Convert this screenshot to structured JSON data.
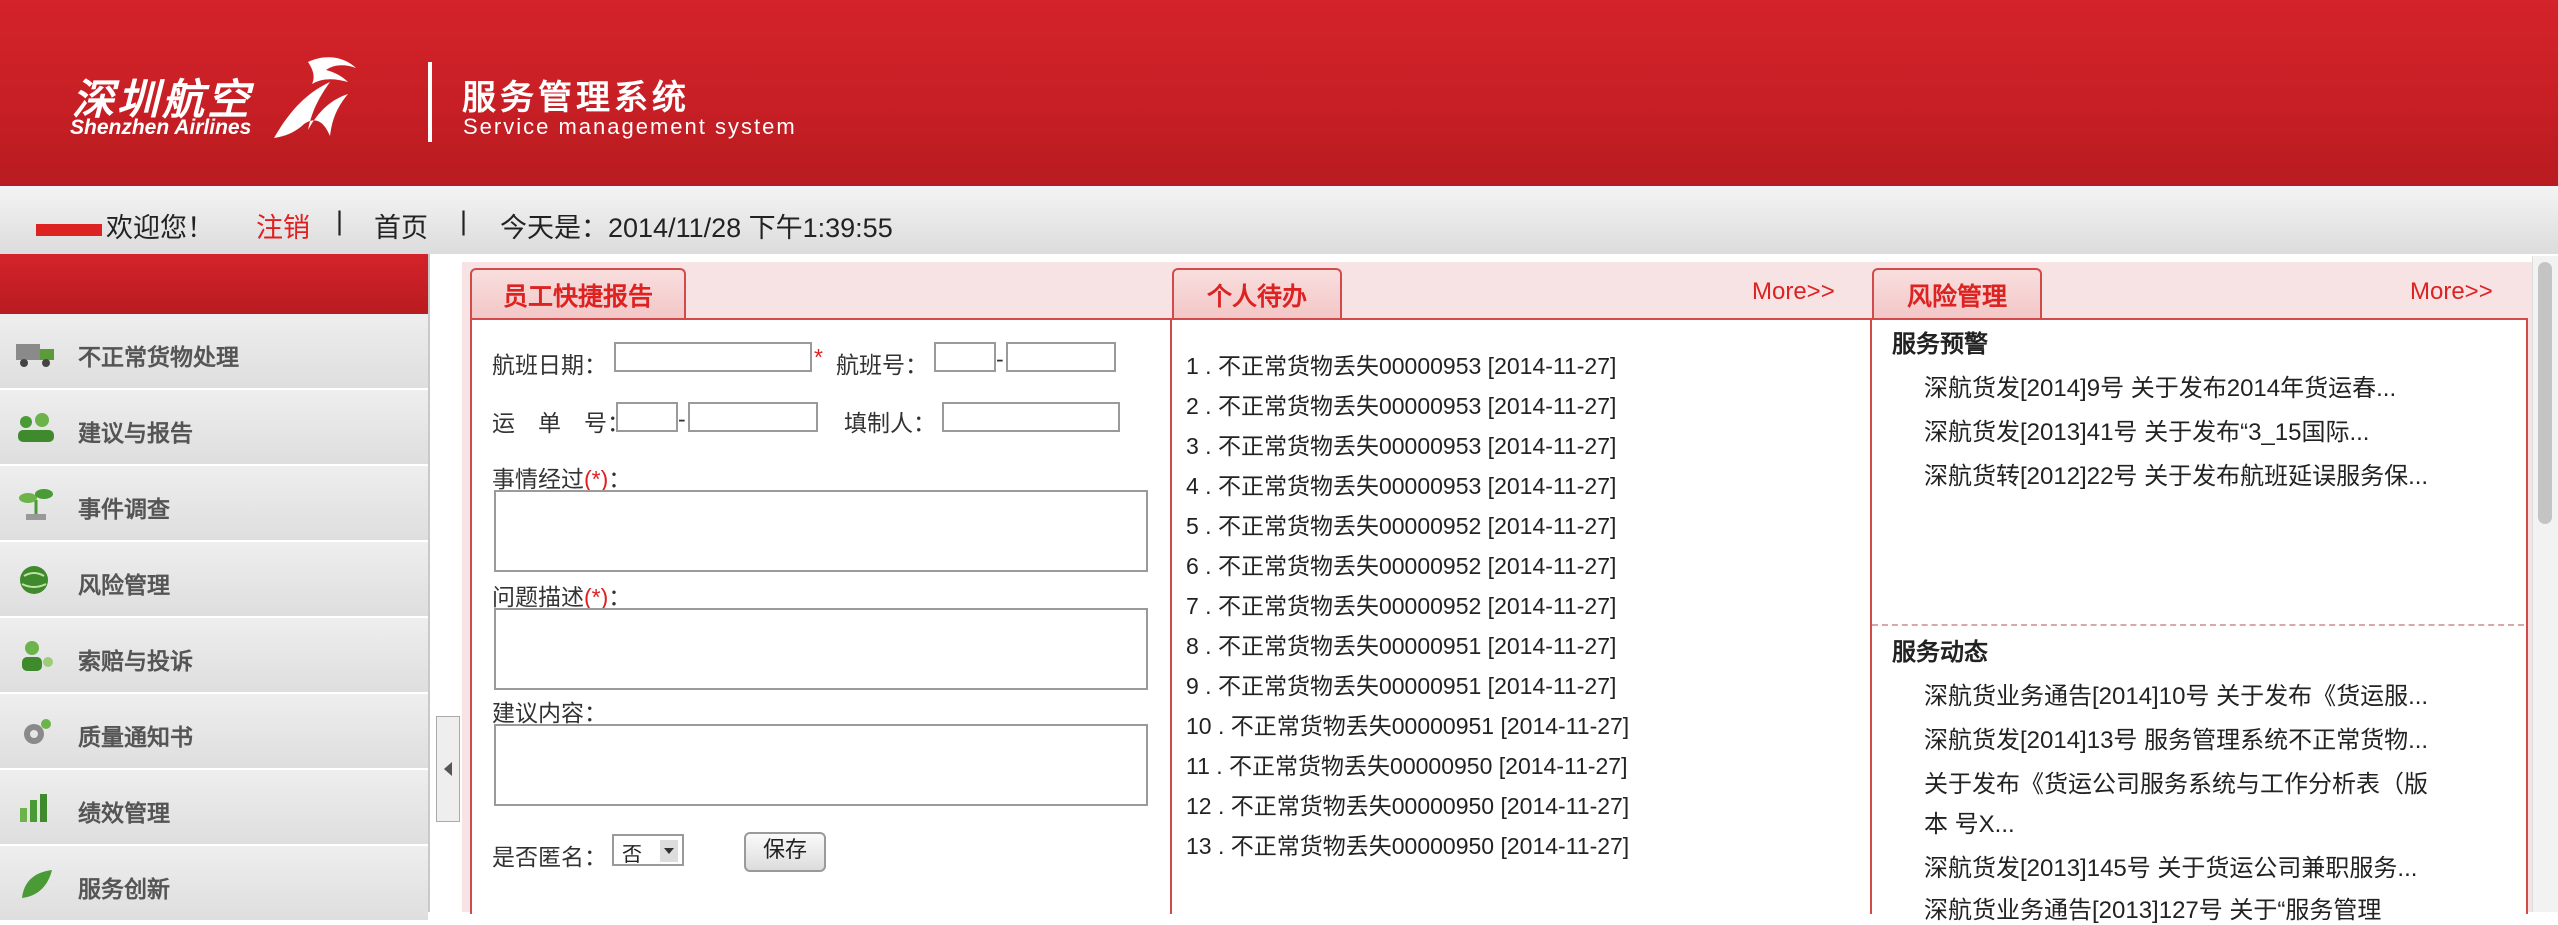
{
  "header": {
    "brand_cn": "深圳航空",
    "brand_en": "Shenzhen Airlines",
    "system_cn": "服务管理系统",
    "system_en": "Service management system"
  },
  "infobar": {
    "welcome": "欢迎您！",
    "logout": "注销",
    "sep": "|",
    "home": "首页",
    "today": "今天是：2014/11/28 下午1:39:55"
  },
  "sidebar": {
    "items": [
      {
        "label": "不正常货物处理",
        "icon": "truck-icon"
      },
      {
        "label": "建议与报告",
        "icon": "people-icon"
      },
      {
        "label": "事件调查",
        "icon": "plant-icon"
      },
      {
        "label": "风险管理",
        "icon": "globe-icon"
      },
      {
        "label": "索赔与投诉",
        "icon": "person-icon"
      },
      {
        "label": "质量通知书",
        "icon": "gear-icon"
      },
      {
        "label": "绩效管理",
        "icon": "chart-icon"
      },
      {
        "label": "服务创新",
        "icon": "leaf-icon"
      }
    ]
  },
  "report": {
    "tab": "员工快捷报告",
    "flight_date": "航班日期：",
    "flight_no": "航班号：",
    "dash": "-",
    "waybill": "运　单　号：",
    "filler": "填制人：",
    "process": "事情经过",
    "problem": "问题描述",
    "required": "(*)",
    "star": "*",
    "colon": "：",
    "suggestion": "建议内容：",
    "anonymous": "是否匿名：",
    "anonymous_value": "否",
    "save": "保存"
  },
  "todo": {
    "tab": "个人待办",
    "more": "More>>",
    "items": [
      "1 . 不正常货物丢失00000953 [2014-11-27]",
      "2 . 不正常货物丢失00000953 [2014-11-27]",
      "3 . 不正常货物丢失00000953 [2014-11-27]",
      "4 . 不正常货物丢失00000953 [2014-11-27]",
      "5 . 不正常货物丢失00000952 [2014-11-27]",
      "6 . 不正常货物丢失00000952 [2014-11-27]",
      "7 . 不正常货物丢失00000952 [2014-11-27]",
      "8 . 不正常货物丢失00000951 [2014-11-27]",
      "9 . 不正常货物丢失00000951 [2014-11-27]",
      "10 . 不正常货物丢失00000951 [2014-11-27]",
      "11 . 不正常货物丢失00000950 [2014-11-27]",
      "12 . 不正常货物丢失00000950 [2014-11-27]",
      "13 . 不正常货物丢失00000950 [2014-11-27]"
    ]
  },
  "risk": {
    "tab": "风险管理",
    "more": "More>>",
    "warning_title": "服务预警",
    "warnings": [
      "深航货发[2014]9号 关于发布2014年货运春...",
      "深航货发[2013]41号 关于发布“3_15国际...",
      "深航货转[2012]22号 关于发布航班延误服务保..."
    ],
    "news_title": "服务动态",
    "news": [
      "深航货业务通告[2014]10号 关于发布《货运服...",
      "深航货发[2014]13号 服务管理系统不正常货物...",
      "关于发布《货运公司服务系统与工作分析表（版",
      "本 号X...",
      "深航货发[2013]145号 关于货运公司兼职服务...",
      "深航货业务通告[2013]127号 关于“服务管理"
    ]
  }
}
